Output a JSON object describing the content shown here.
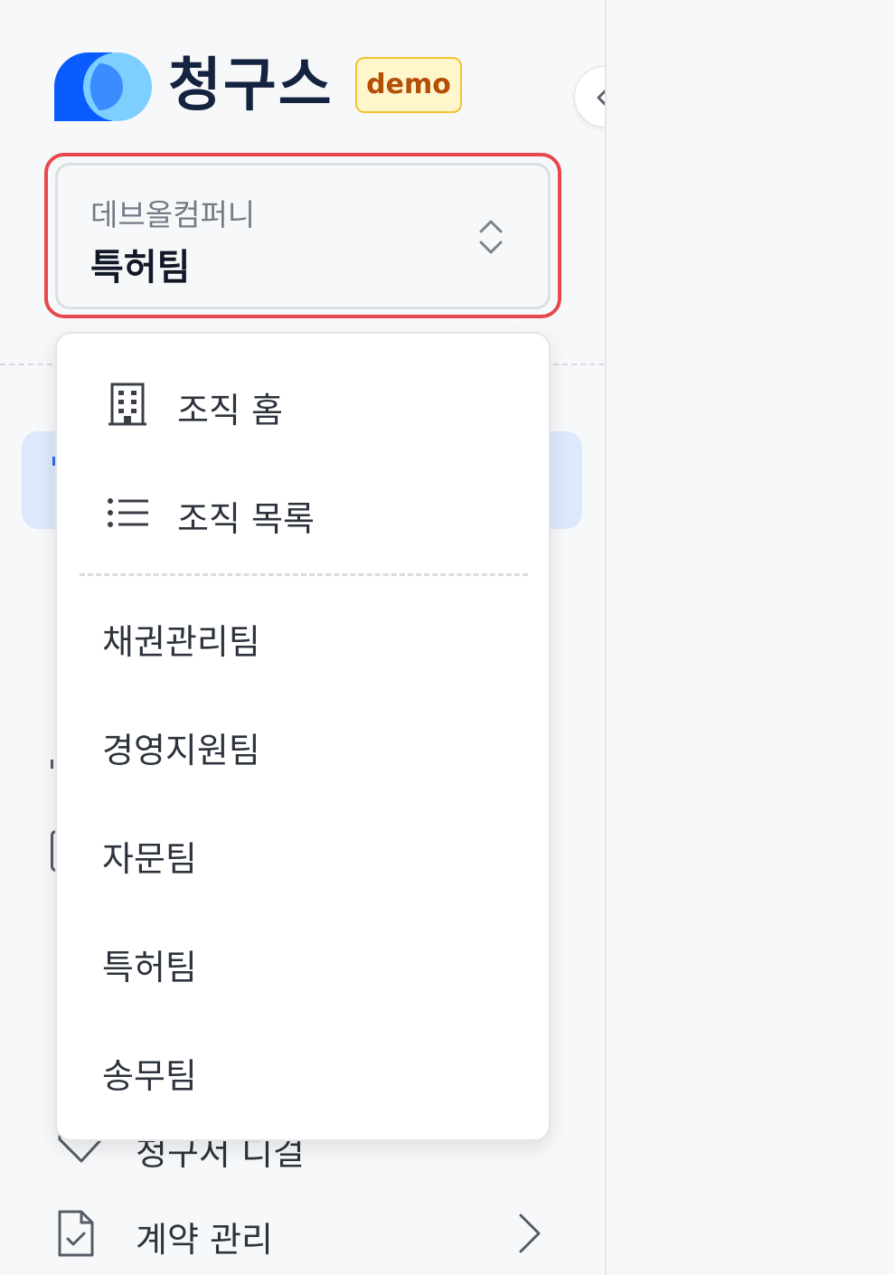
{
  "brand": {
    "name": "청구스",
    "badge": "demo",
    "colors": {
      "primary": "#0a5cff",
      "secondary": "#7ccfff",
      "badge_border": "#f2c231",
      "badge_bg": "#fff6cc",
      "badge_text": "#b34f06"
    }
  },
  "sidebar": {
    "collapse_icon": "chevron-left-icon",
    "org_switcher": {
      "organization": "데브올컴퍼니",
      "team": "특허팀",
      "icon": "chevron-up-down-icon",
      "highlight_color": "#e5484d"
    },
    "nav": [
      {
        "label": "청구서 디걸",
        "icon": "tag-icon"
      },
      {
        "label": "계약 관리",
        "icon": "file-check-icon",
        "trailing_icon": "chevron-right-icon"
      }
    ]
  },
  "dropdown": {
    "actions": [
      {
        "label": "조직 홈",
        "icon": "building-icon"
      },
      {
        "label": "조직 목록",
        "icon": "list-icon"
      }
    ],
    "teams": [
      "채권관리팀",
      "경영지원팀",
      "자문팀",
      "특허팀",
      "송무팀"
    ]
  }
}
